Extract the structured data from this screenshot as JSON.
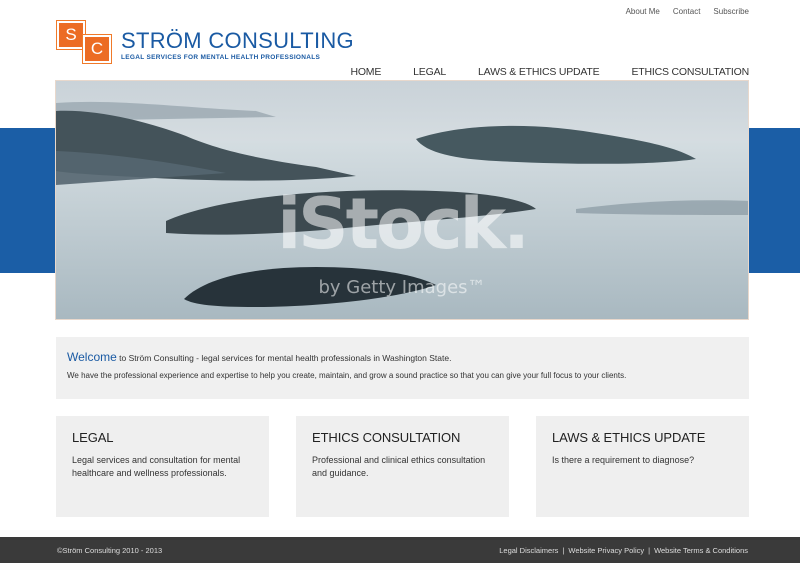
{
  "utility_nav": [
    "About Me",
    "Contact",
    "Subscribe"
  ],
  "logo": {
    "letter_1": "S",
    "letter_2": "C",
    "name": "STRÖM CONSULTING",
    "tagline": "LEGAL SERVICES FOR MENTAL HEALTH PROFESSIONALS"
  },
  "nav": [
    {
      "label": "HOME",
      "active": true
    },
    {
      "label": "LEGAL",
      "active": false
    },
    {
      "label": "LAWS & ETHICS UPDATE",
      "active": false
    },
    {
      "label": "ETHICS CONSULTATION",
      "active": false
    }
  ],
  "hero": {
    "watermark_line1": "iStock.",
    "watermark_line2": "by Getty Images™"
  },
  "welcome": {
    "highlight": "Welcome",
    "line1_rest": " to Ström Consulting - legal services for mental health professionals in Washington State.",
    "line2": "We have the professional experience and expertise to help you create, maintain, and grow a sound practice so that you can give your full focus to your clients."
  },
  "cards": [
    {
      "title": "LEGAL",
      "body": "Legal services and consultation for mental healthcare and wellness professionals."
    },
    {
      "title": "ETHICS CONSULTATION",
      "body": "Professional and clinical ethics consultation and guidance."
    },
    {
      "title": "LAWS & ETHICS UPDATE",
      "body": "Is there a requirement to diagnose?"
    }
  ],
  "footer": {
    "copyright": "©Ström Consulting 2010 - 2013",
    "links": [
      "Legal Disclaimers",
      "Website Privacy Policy",
      "Website Terms & Conditions"
    ],
    "separator": "|"
  },
  "colors": {
    "brand_blue": "#1a5aa3",
    "band_blue": "#1b5ea6",
    "accent_orange": "#ec6c24",
    "footer_bg": "#3a3a3a",
    "panel_gray": "#efefef"
  }
}
